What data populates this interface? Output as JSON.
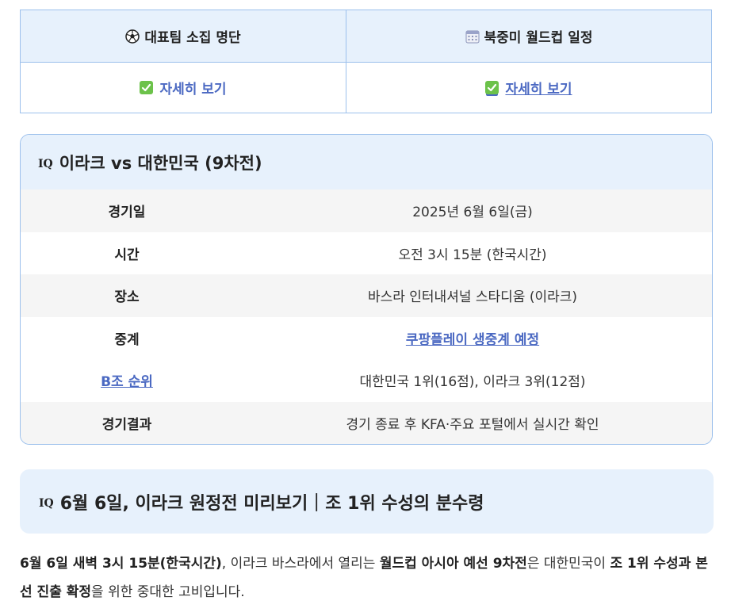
{
  "links_table": {
    "col1_header": "대표팀 소집 명단",
    "col1_icon": "soccer-ball-icon",
    "col2_header": "북중미 월드컵 일정",
    "col2_icon": "calendar-icon",
    "col1_link": "자세히 보기",
    "col2_link": "자세히 보기"
  },
  "match_card": {
    "flag_code": "IQ",
    "title": "이라크 vs 대한민국 (9차전)",
    "rows": [
      {
        "label": "경기일",
        "value": "2025년 6월 6일(금)"
      },
      {
        "label": "시간",
        "value": "오전 3시 15분 (한국시간)"
      },
      {
        "label": "장소",
        "value": "바스라 인터내셔널 스타디움 (이라크)"
      },
      {
        "label": "중계",
        "value": "쿠팡플레이 생중계 예정"
      },
      {
        "label": "B조 순위",
        "value": "대한민국 1위(16점), 이라크 3위(12점)"
      },
      {
        "label": "경기결과",
        "value": "경기 종료 후 KFA·주요 포털에서 실시간 확인"
      }
    ]
  },
  "section": {
    "flag_code": "IQ",
    "heading": "6월 6일, 이라크 원정전 미리보기｜조 1위 수성의 분수령"
  },
  "intro": {
    "p1": "6월 6일 새벽 3시 15분(한국시간)",
    "p2": ", 이라크 바스라에서 열리는 ",
    "p3": "월드컵 아시아 예선 9차전",
    "p4": "은 대한민국이 ",
    "p5": "조 1위 수성과 본선 진출 확정",
    "p6": "을 위한 중대한 고비입니다."
  },
  "colors": {
    "accent_bg": "#e7f1fc",
    "border": "#9cc0ec",
    "link": "#4b69c2",
    "check_green": "#6cc24a"
  }
}
